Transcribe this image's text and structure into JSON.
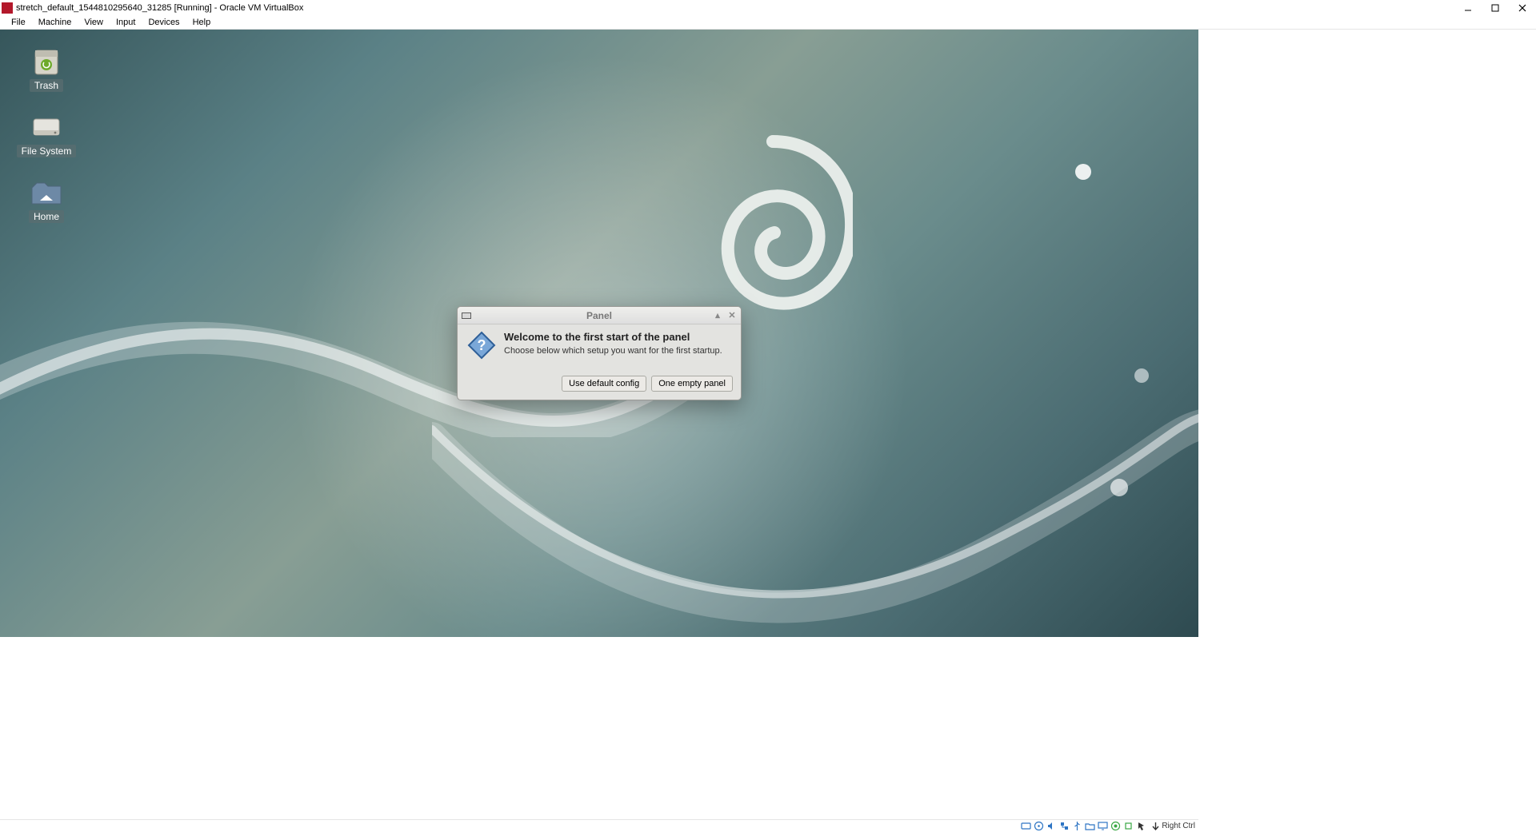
{
  "window": {
    "title": "stretch_default_1544810295640_31285 [Running] - Oracle VM VirtualBox"
  },
  "menu": {
    "file": "File",
    "machine": "Machine",
    "view": "View",
    "input": "Input",
    "devices": "Devices",
    "help": "Help"
  },
  "desktop": {
    "trash": "Trash",
    "filesystem": "File System",
    "home": "Home"
  },
  "dialog": {
    "title": "Panel",
    "heading": "Welcome to the first start of the panel",
    "message": "Choose below which setup you want for the first startup.",
    "btn_default": "Use default config",
    "btn_empty": "One empty panel"
  },
  "statusbar": {
    "hostkey": "Right Ctrl"
  }
}
